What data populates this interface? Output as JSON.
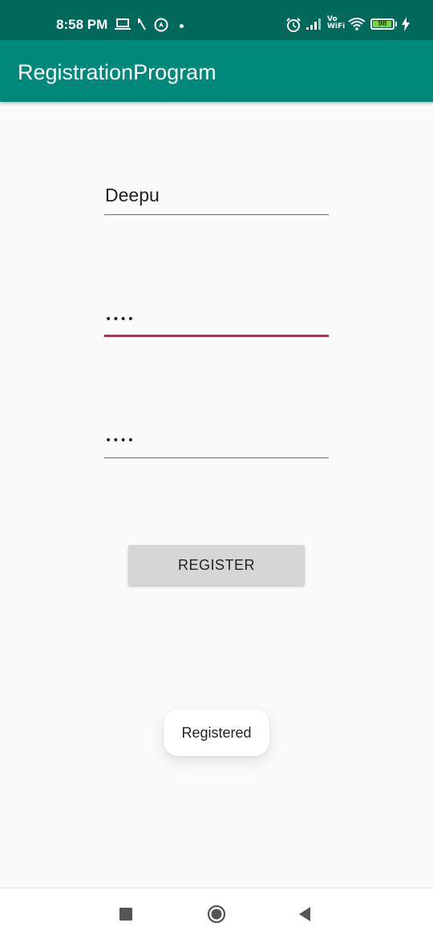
{
  "status_bar": {
    "time": "8:58 PM",
    "vowifi": "Vo\nWiFi",
    "battery": "98",
    "icons": [
      "laptop-icon",
      "slash-icon",
      "navigation-icon",
      "dot-icon",
      "alarm-icon",
      "signal-icon",
      "vowifi-icon",
      "wifi-icon",
      "battery-icon",
      "charging-icon"
    ]
  },
  "app_bar": {
    "title": "RegistrationProgram",
    "color": "#00897b"
  },
  "form": {
    "username_value": "Deepu",
    "password_value": "••••",
    "confirm_password_value": "••••",
    "focus_color": "#d81b60",
    "register_label": "REGISTER"
  },
  "toast": {
    "message": "Registered"
  },
  "nav_bar": {
    "icons": [
      "recent-apps-icon",
      "home-icon",
      "back-icon"
    ]
  }
}
